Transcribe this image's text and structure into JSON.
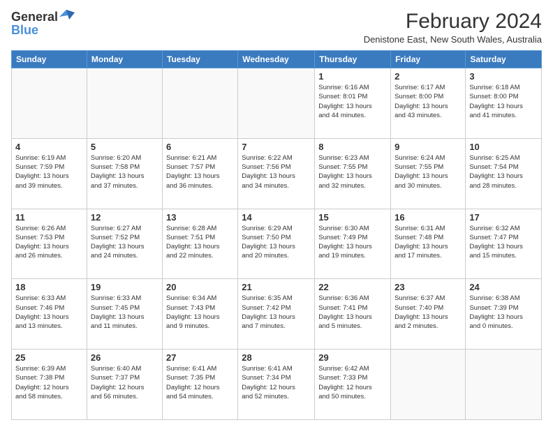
{
  "logo": {
    "line1": "General",
    "line2": "Blue"
  },
  "header": {
    "title": "February 2024",
    "location": "Denistone East, New South Wales, Australia"
  },
  "weekdays": [
    "Sunday",
    "Monday",
    "Tuesday",
    "Wednesday",
    "Thursday",
    "Friday",
    "Saturday"
  ],
  "weeks": [
    [
      {
        "day": "",
        "info": ""
      },
      {
        "day": "",
        "info": ""
      },
      {
        "day": "",
        "info": ""
      },
      {
        "day": "",
        "info": ""
      },
      {
        "day": "1",
        "info": "Sunrise: 6:16 AM\nSunset: 8:01 PM\nDaylight: 13 hours\nand 44 minutes."
      },
      {
        "day": "2",
        "info": "Sunrise: 6:17 AM\nSunset: 8:00 PM\nDaylight: 13 hours\nand 43 minutes."
      },
      {
        "day": "3",
        "info": "Sunrise: 6:18 AM\nSunset: 8:00 PM\nDaylight: 13 hours\nand 41 minutes."
      }
    ],
    [
      {
        "day": "4",
        "info": "Sunrise: 6:19 AM\nSunset: 7:59 PM\nDaylight: 13 hours\nand 39 minutes."
      },
      {
        "day": "5",
        "info": "Sunrise: 6:20 AM\nSunset: 7:58 PM\nDaylight: 13 hours\nand 37 minutes."
      },
      {
        "day": "6",
        "info": "Sunrise: 6:21 AM\nSunset: 7:57 PM\nDaylight: 13 hours\nand 36 minutes."
      },
      {
        "day": "7",
        "info": "Sunrise: 6:22 AM\nSunset: 7:56 PM\nDaylight: 13 hours\nand 34 minutes."
      },
      {
        "day": "8",
        "info": "Sunrise: 6:23 AM\nSunset: 7:55 PM\nDaylight: 13 hours\nand 32 minutes."
      },
      {
        "day": "9",
        "info": "Sunrise: 6:24 AM\nSunset: 7:55 PM\nDaylight: 13 hours\nand 30 minutes."
      },
      {
        "day": "10",
        "info": "Sunrise: 6:25 AM\nSunset: 7:54 PM\nDaylight: 13 hours\nand 28 minutes."
      }
    ],
    [
      {
        "day": "11",
        "info": "Sunrise: 6:26 AM\nSunset: 7:53 PM\nDaylight: 13 hours\nand 26 minutes."
      },
      {
        "day": "12",
        "info": "Sunrise: 6:27 AM\nSunset: 7:52 PM\nDaylight: 13 hours\nand 24 minutes."
      },
      {
        "day": "13",
        "info": "Sunrise: 6:28 AM\nSunset: 7:51 PM\nDaylight: 13 hours\nand 22 minutes."
      },
      {
        "day": "14",
        "info": "Sunrise: 6:29 AM\nSunset: 7:50 PM\nDaylight: 13 hours\nand 20 minutes."
      },
      {
        "day": "15",
        "info": "Sunrise: 6:30 AM\nSunset: 7:49 PM\nDaylight: 13 hours\nand 19 minutes."
      },
      {
        "day": "16",
        "info": "Sunrise: 6:31 AM\nSunset: 7:48 PM\nDaylight: 13 hours\nand 17 minutes."
      },
      {
        "day": "17",
        "info": "Sunrise: 6:32 AM\nSunset: 7:47 PM\nDaylight: 13 hours\nand 15 minutes."
      }
    ],
    [
      {
        "day": "18",
        "info": "Sunrise: 6:33 AM\nSunset: 7:46 PM\nDaylight: 13 hours\nand 13 minutes."
      },
      {
        "day": "19",
        "info": "Sunrise: 6:33 AM\nSunset: 7:45 PM\nDaylight: 13 hours\nand 11 minutes."
      },
      {
        "day": "20",
        "info": "Sunrise: 6:34 AM\nSunset: 7:43 PM\nDaylight: 13 hours\nand 9 minutes."
      },
      {
        "day": "21",
        "info": "Sunrise: 6:35 AM\nSunset: 7:42 PM\nDaylight: 13 hours\nand 7 minutes."
      },
      {
        "day": "22",
        "info": "Sunrise: 6:36 AM\nSunset: 7:41 PM\nDaylight: 13 hours\nand 5 minutes."
      },
      {
        "day": "23",
        "info": "Sunrise: 6:37 AM\nSunset: 7:40 PM\nDaylight: 13 hours\nand 2 minutes."
      },
      {
        "day": "24",
        "info": "Sunrise: 6:38 AM\nSunset: 7:39 PM\nDaylight: 13 hours\nand 0 minutes."
      }
    ],
    [
      {
        "day": "25",
        "info": "Sunrise: 6:39 AM\nSunset: 7:38 PM\nDaylight: 12 hours\nand 58 minutes."
      },
      {
        "day": "26",
        "info": "Sunrise: 6:40 AM\nSunset: 7:37 PM\nDaylight: 12 hours\nand 56 minutes."
      },
      {
        "day": "27",
        "info": "Sunrise: 6:41 AM\nSunset: 7:35 PM\nDaylight: 12 hours\nand 54 minutes."
      },
      {
        "day": "28",
        "info": "Sunrise: 6:41 AM\nSunset: 7:34 PM\nDaylight: 12 hours\nand 52 minutes."
      },
      {
        "day": "29",
        "info": "Sunrise: 6:42 AM\nSunset: 7:33 PM\nDaylight: 12 hours\nand 50 minutes."
      },
      {
        "day": "",
        "info": ""
      },
      {
        "day": "",
        "info": ""
      }
    ]
  ]
}
